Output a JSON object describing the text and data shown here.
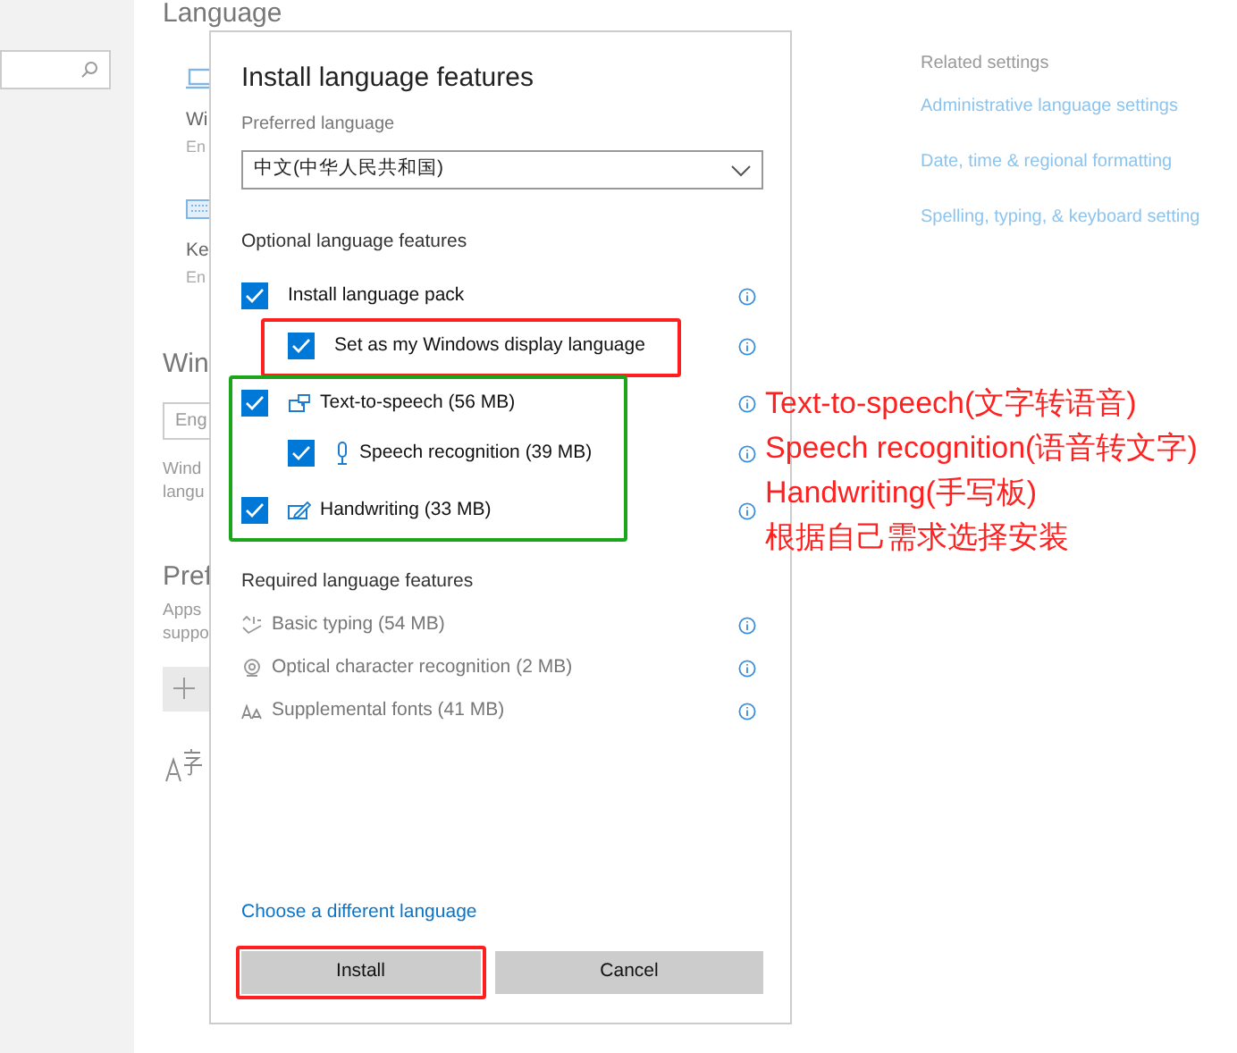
{
  "background_page": {
    "title": "Language",
    "fragments": [
      {
        "kind": "laptop"
      },
      {
        "kind": "label",
        "text": "Wi"
      },
      {
        "kind": "sub",
        "text": "En"
      },
      {
        "kind": "keyboard"
      },
      {
        "kind": "label",
        "text": "Ke"
      },
      {
        "kind": "sub",
        "text": "En"
      },
      {
        "kind": "heading",
        "text": "Win"
      },
      {
        "kind": "field",
        "text": "Eng"
      },
      {
        "kind": "note",
        "text": "Wind"
      },
      {
        "kind": "note",
        "text": "langu"
      },
      {
        "kind": "heading",
        "text": "Pref"
      },
      {
        "kind": "note",
        "text": "Apps"
      },
      {
        "kind": "note",
        "text": "suppo"
      },
      {
        "kind": "add"
      },
      {
        "kind": "glyph"
      }
    ],
    "related_settings": {
      "heading": "Related settings",
      "links": [
        "Administrative language settings",
        "Date, time & regional formatting",
        "Spelling, typing, & keyboard setting"
      ]
    }
  },
  "dialog": {
    "title": "Install language features",
    "preferred_language": {
      "label": "Preferred language",
      "value": "中文(中华人民共和国)"
    },
    "optional_heading": "Optional language features",
    "optional_features": [
      {
        "label": "Install language pack",
        "checked": true,
        "children": [
          {
            "label": "Set as my Windows display language",
            "checked": true,
            "color": "#ff1f1f"
          }
        ]
      },
      {
        "label": "Text-to-speech (56 MB)",
        "checked": true,
        "color": "#1aa51a",
        "children": [
          {
            "label": "Speech recognition (39 MB)",
            "checked": true
          }
        ]
      },
      {
        "label": "Handwriting (33 MB)",
        "checked": true,
        "color": "#1aa51a"
      }
    ],
    "required_heading": "Required language features",
    "required_features": [
      "Basic typing (54 MB)",
      "Optical character recognition (2 MB)",
      "Supplemental fonts (41 MB)"
    ],
    "link": "Choose a different language",
    "buttons": [
      {
        "label": "Install",
        "color": "#ff1f1f"
      },
      {
        "label": "Cancel"
      }
    ]
  },
  "annotation": {
    "lines": [
      "Text-to-speech(文字转语音)",
      "Speech recognition(语音转文字)",
      "Handwriting(手写板)",
      "根据自己需求选择安装"
    ]
  }
}
